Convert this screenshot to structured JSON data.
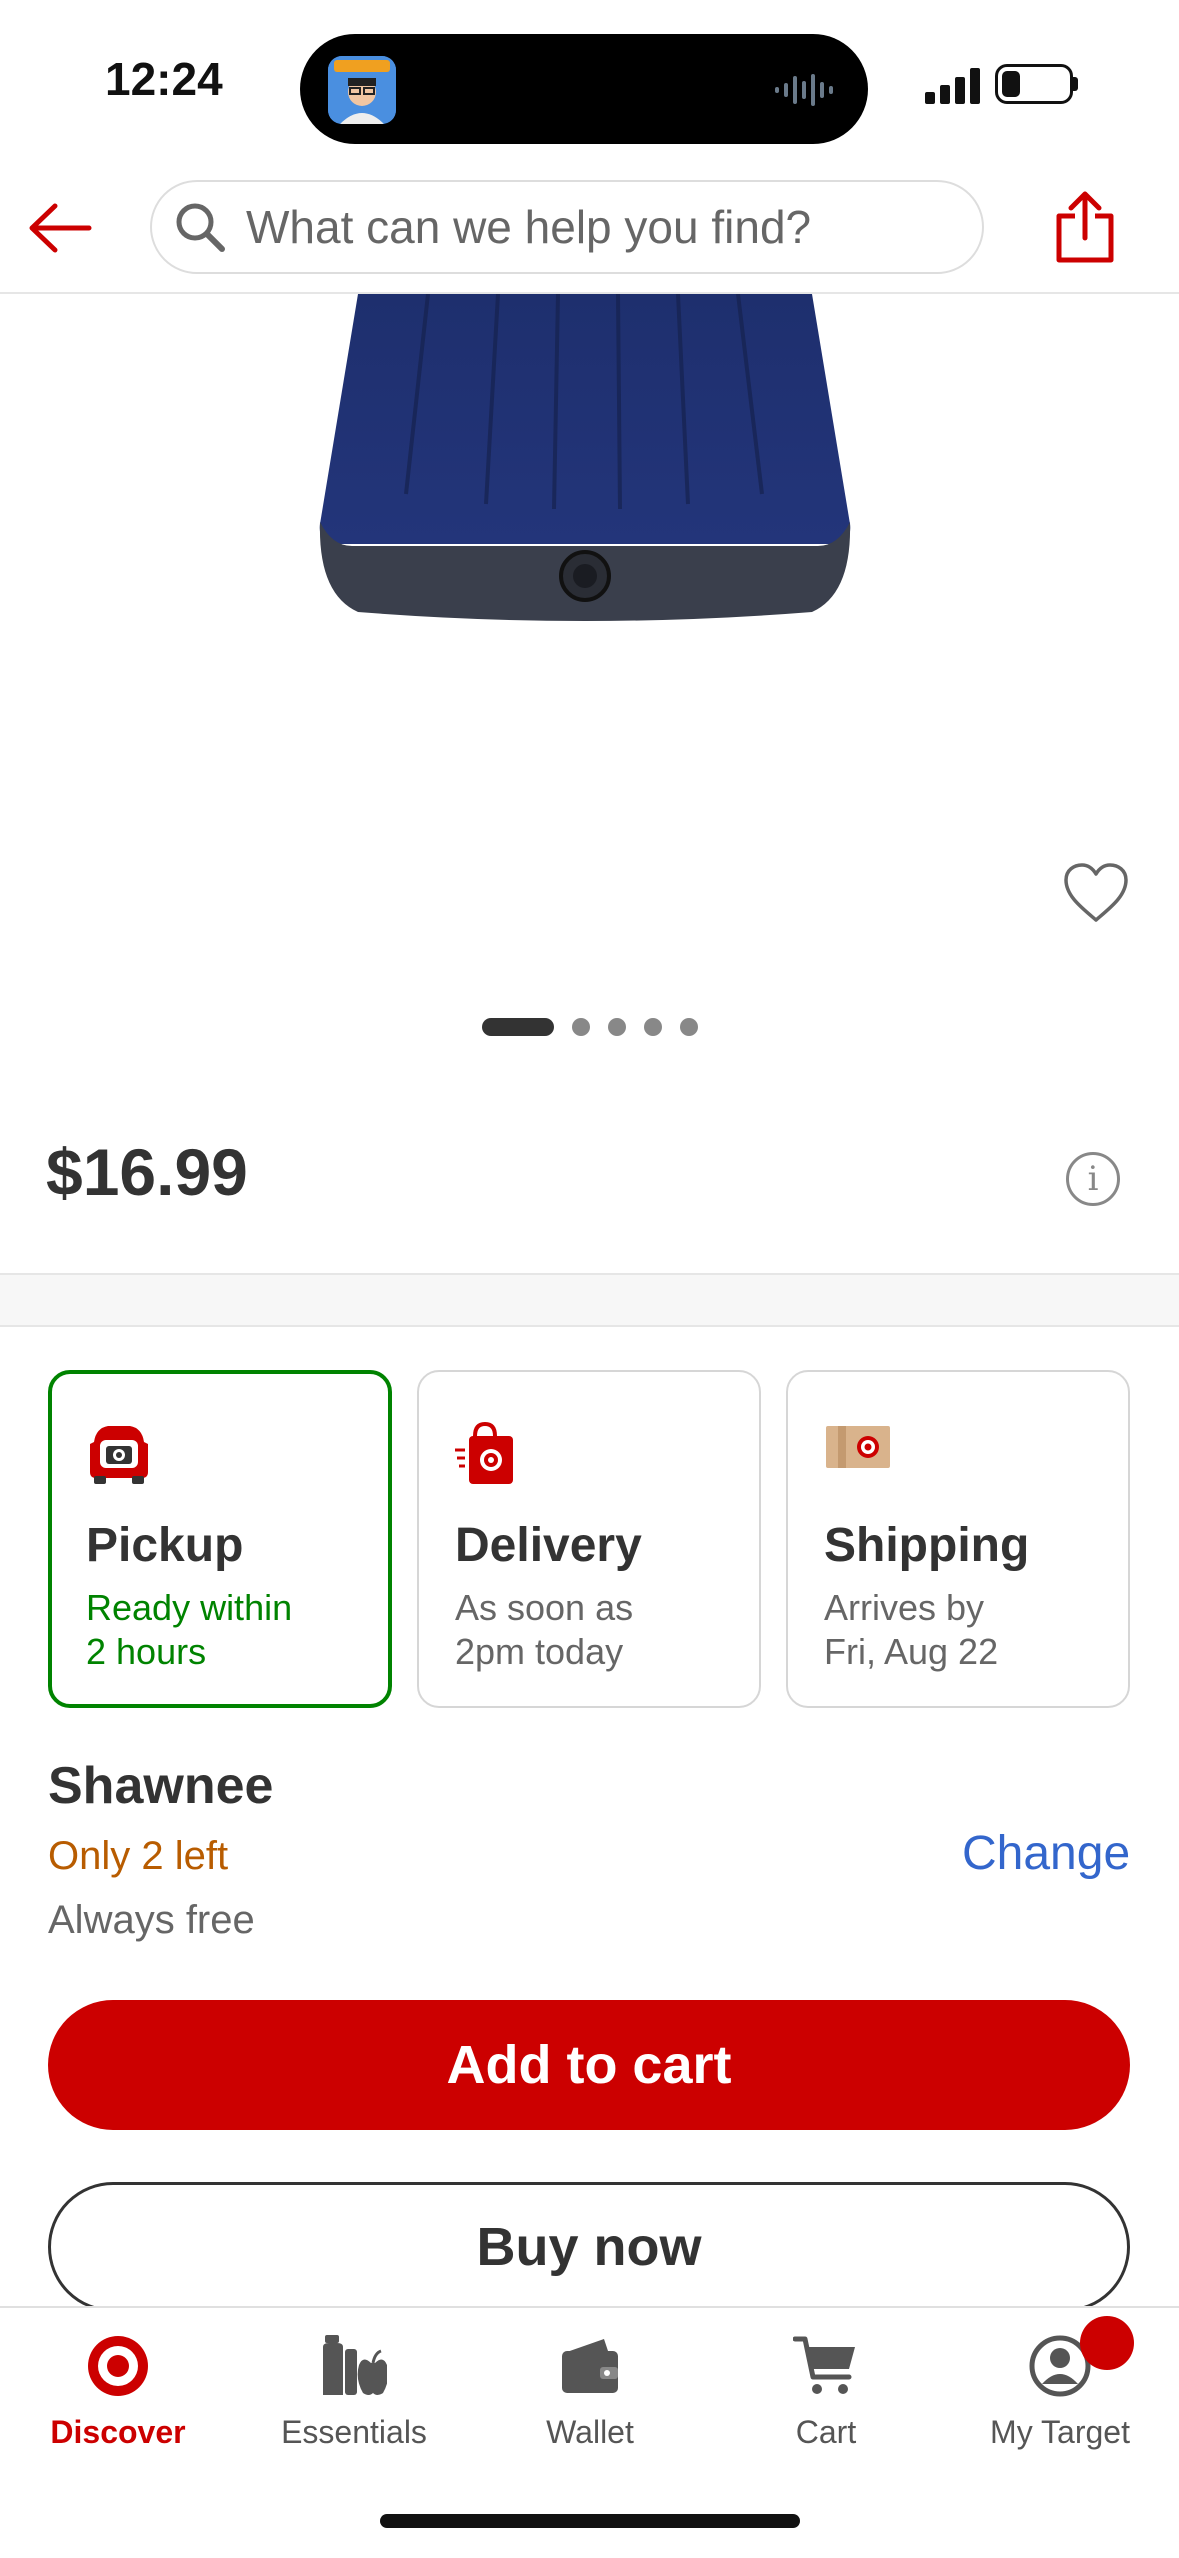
{
  "status_bar": {
    "time": "12:24"
  },
  "header": {
    "search_placeholder": "What can we help you find?"
  },
  "product": {
    "price": "$16.99",
    "image_count": 5,
    "active_image_index": 0
  },
  "fulfillment": {
    "options": [
      {
        "title": "Pickup",
        "line1": "Ready within",
        "line2": "2 hours",
        "selected": true
      },
      {
        "title": "Delivery",
        "line1": "As soon as",
        "line2": "2pm today",
        "selected": false
      },
      {
        "title": "Shipping",
        "line1": "Arrives by",
        "line2": "Fri, Aug 22",
        "selected": false
      }
    ],
    "store": "Shawnee",
    "stock": "Only 2 left",
    "price_note": "Always free",
    "change_label": "Change"
  },
  "actions": {
    "add_to_cart": "Add to cart",
    "buy_now": "Buy now"
  },
  "bottom_nav": {
    "items": [
      {
        "label": "Discover",
        "icon": "target-logo-icon",
        "active": true
      },
      {
        "label": "Essentials",
        "icon": "essentials-icon",
        "active": false
      },
      {
        "label": "Wallet",
        "icon": "wallet-icon",
        "active": false
      },
      {
        "label": "Cart",
        "icon": "cart-icon",
        "active": false
      },
      {
        "label": "My Target",
        "icon": "profile-icon",
        "active": false
      }
    ]
  },
  "colors": {
    "brand_red": "#cc0000",
    "selected_green": "#008300",
    "stock_orange": "#b85c00",
    "link_blue": "#3366cc"
  }
}
